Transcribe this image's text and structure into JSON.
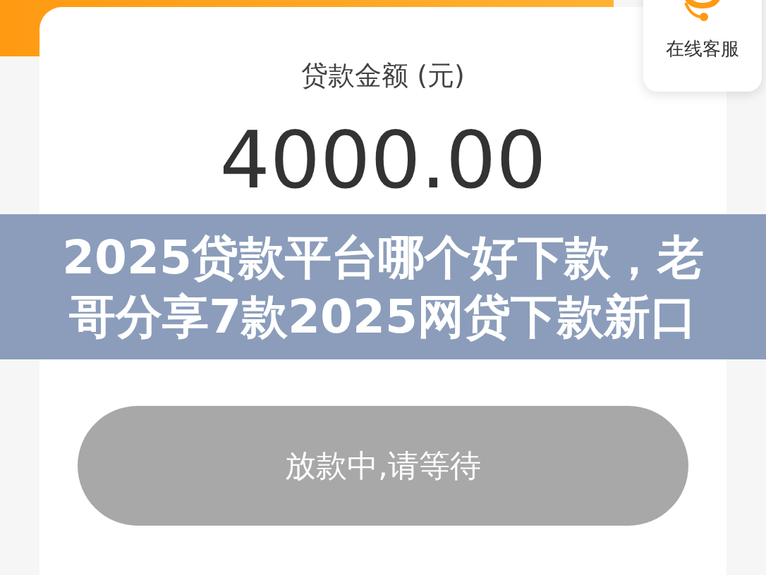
{
  "customer_service": {
    "label": "在线客服"
  },
  "loan": {
    "label": "贷款金额 (元)",
    "amount": "4000.00"
  },
  "action_button": {
    "label": "放款中,请等待",
    "disabled": true
  },
  "banner": {
    "title": "2025贷款平台哪个好下款，老哥分享7款2025网贷下款新口"
  }
}
